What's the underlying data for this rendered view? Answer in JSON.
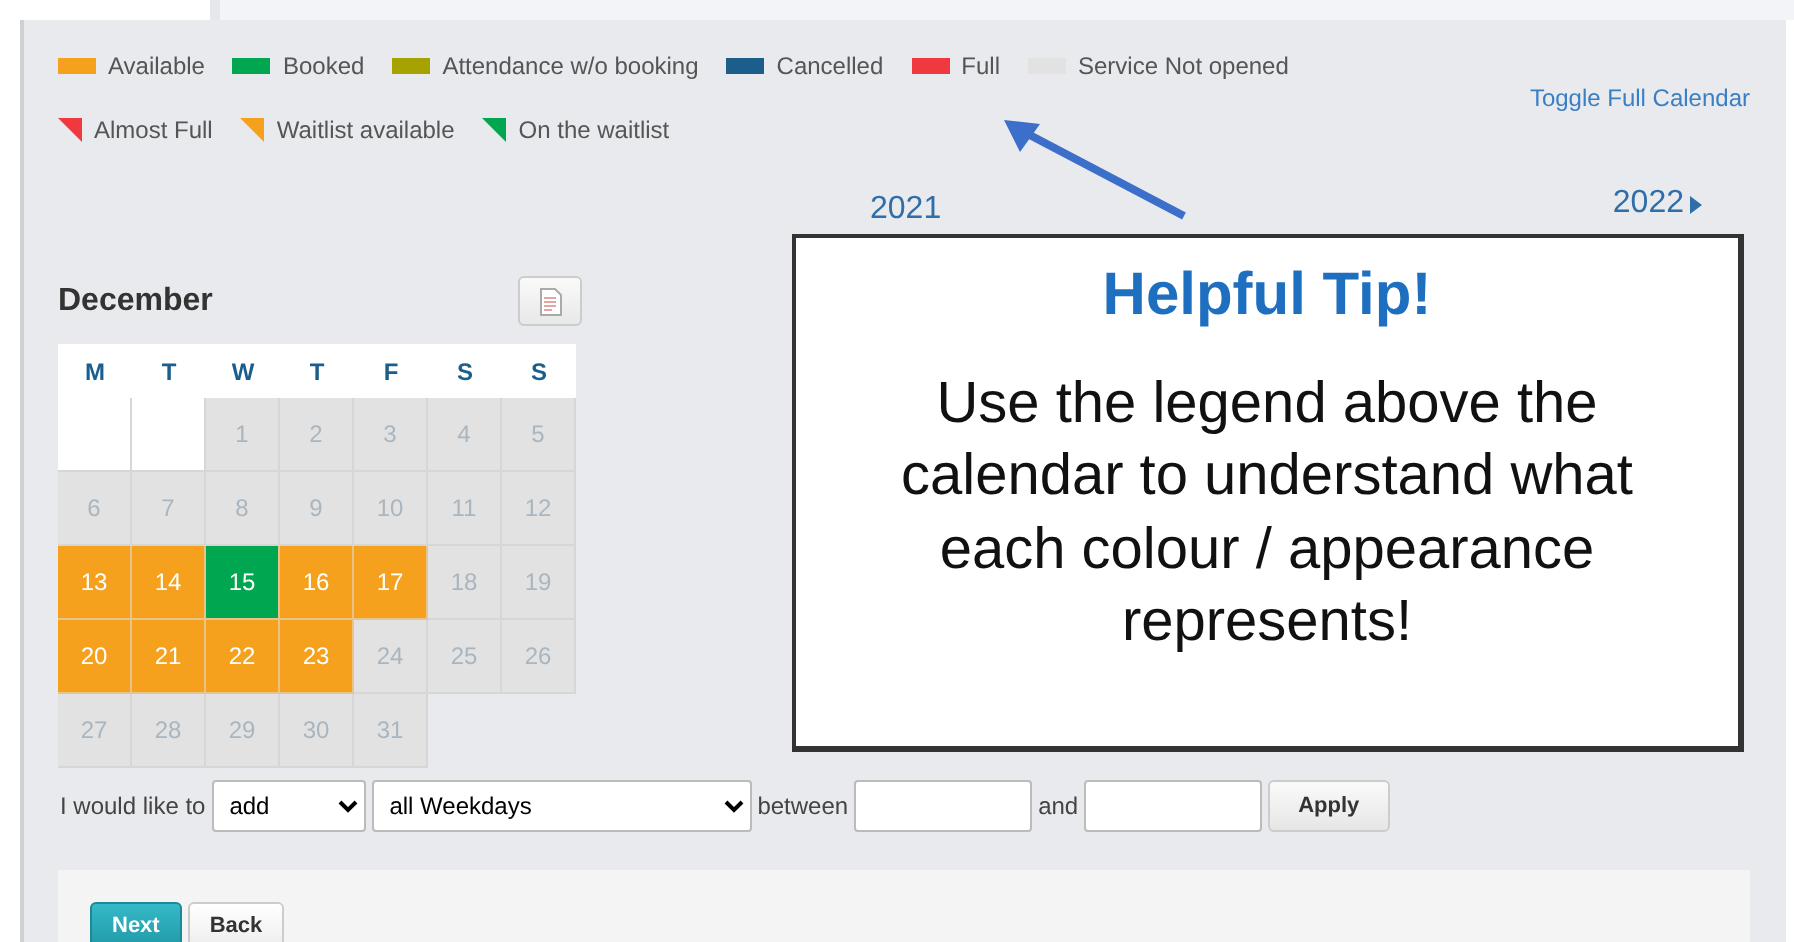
{
  "legend": [
    {
      "kind": "swatch",
      "color": "#f5a11e",
      "label": "Available"
    },
    {
      "kind": "swatch",
      "color": "#00a650",
      "label": "Booked"
    },
    {
      "kind": "swatch",
      "color": "#a6a300",
      "label": "Attendance w/o booking"
    },
    {
      "kind": "swatch",
      "color": "#1b5e8c",
      "label": "Cancelled"
    },
    {
      "kind": "swatch",
      "color": "#f0383f",
      "label": "Full"
    },
    {
      "kind": "swatch",
      "color": "#e2e2e2",
      "label": "Service Not opened"
    },
    {
      "kind": "corner",
      "color": "#f0383f",
      "label": "Almost Full"
    },
    {
      "kind": "corner",
      "color": "#f5a11e",
      "label": "Waitlist available"
    },
    {
      "kind": "corner",
      "color": "#00a650",
      "label": "On the waitlist"
    }
  ],
  "toggle_link": "Toggle Full Calendar",
  "year_current": "2021",
  "year_next": "2022",
  "calendar": {
    "month": "December",
    "weekdays": [
      "M",
      "T",
      "W",
      "T",
      "F",
      "S",
      "S"
    ],
    "weeks": [
      [
        {
          "kind": "blank"
        },
        {
          "kind": "blank"
        },
        {
          "day": "1",
          "kind": "closed"
        },
        {
          "day": "2",
          "kind": "closed"
        },
        {
          "day": "3",
          "kind": "closed"
        },
        {
          "day": "4",
          "kind": "closed"
        },
        {
          "day": "5",
          "kind": "closed"
        }
      ],
      [
        {
          "day": "6",
          "kind": "closed"
        },
        {
          "day": "7",
          "kind": "closed"
        },
        {
          "day": "8",
          "kind": "closed"
        },
        {
          "day": "9",
          "kind": "closed"
        },
        {
          "day": "10",
          "kind": "closed"
        },
        {
          "day": "11",
          "kind": "closed"
        },
        {
          "day": "12",
          "kind": "closed"
        }
      ],
      [
        {
          "day": "13",
          "kind": "available"
        },
        {
          "day": "14",
          "kind": "available"
        },
        {
          "day": "15",
          "kind": "booked"
        },
        {
          "day": "16",
          "kind": "available"
        },
        {
          "day": "17",
          "kind": "available"
        },
        {
          "day": "18",
          "kind": "closed"
        },
        {
          "day": "19",
          "kind": "closed"
        }
      ],
      [
        {
          "day": "20",
          "kind": "available"
        },
        {
          "day": "21",
          "kind": "available"
        },
        {
          "day": "22",
          "kind": "available"
        },
        {
          "day": "23",
          "kind": "available"
        },
        {
          "day": "24",
          "kind": "closed"
        },
        {
          "day": "25",
          "kind": "closed"
        },
        {
          "day": "26",
          "kind": "closed"
        }
      ],
      [
        {
          "day": "27",
          "kind": "closed"
        },
        {
          "day": "28",
          "kind": "closed"
        },
        {
          "day": "29",
          "kind": "closed"
        },
        {
          "day": "30",
          "kind": "closed"
        },
        {
          "day": "31",
          "kind": "closed"
        }
      ]
    ]
  },
  "tip": {
    "title": "Helpful Tip!",
    "text": "Use the legend above the calendar to understand what each colour / appearance represents!"
  },
  "form": {
    "label": "I would like to",
    "action": "add",
    "days": "all Weekdays",
    "between": "between",
    "and": "and",
    "apply": "Apply"
  },
  "buttons": [
    {
      "label": "Next",
      "kind": "primary"
    },
    {
      "label": "Back",
      "kind": "secondary"
    }
  ]
}
